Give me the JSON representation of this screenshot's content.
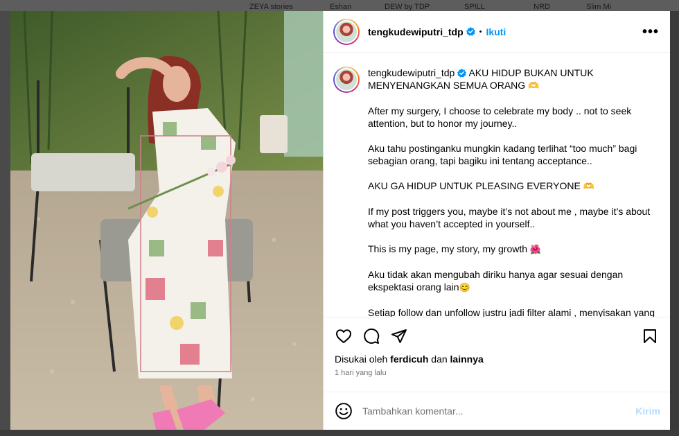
{
  "background": {
    "stories": [
      "ZEYA stories",
      "Eshan",
      "DEW by TDP",
      "SPILL",
      "NRD",
      "Slim Mi"
    ]
  },
  "post": {
    "author": {
      "username": "tengkudewiputri_tdp",
      "verified": true,
      "follow_label": "Ikuti",
      "separator": "•"
    },
    "more_options_icon": "more-horizontal-icon",
    "caption": {
      "username": "tengkudewiputri_tdp",
      "title": "AKU HIDUP BUKAN UNTUK MENYENANGKAN SEMUA ORANG",
      "title_emoji": "🫶",
      "paragraphs": [
        "After my surgery, I choose to celebrate my body .. not to seek attention, but to honor my journey..",
        "Aku tahu postinganku mungkin kadang terlihat “too much” bagi sebagian orang, tapi bagiku ini tentang acceptance..",
        "AKU GA HIDUP UNTUK PLEASING EVERYONE",
        "If my post triggers you, maybe it’s not about me , maybe it’s about what you haven’t accepted in yourself..",
        "This is my page, my story, my growth",
        "Aku tidak akan mengubah diriku hanya agar sesuai dengan ekspektasi orang lain",
        "Setiap follow dan unfollow justru jadi filter alami , menyisakan yang"
      ],
      "emojis": {
        "p2": "🫶",
        "p4": "🌺",
        "p5": "😊"
      }
    },
    "actions": {
      "like_icon": "heart-icon",
      "comment_icon": "comment-icon",
      "share_icon": "send-icon",
      "save_icon": "bookmark-icon"
    },
    "likes": {
      "prefix": "Disukai oleh",
      "user": "ferdicuh",
      "conjunction": "dan",
      "others": "lainnya"
    },
    "timestamp": "1 hari yang lalu",
    "comment_box": {
      "emoji_icon": "smiley-icon",
      "placeholder": "Tambahkan komentar...",
      "post_label": "Kirim"
    }
  },
  "colors": {
    "accent": "#0095f6",
    "post_disabled": "#b3dbff",
    "muted_text": "#737373",
    "divider": "#efefef"
  }
}
